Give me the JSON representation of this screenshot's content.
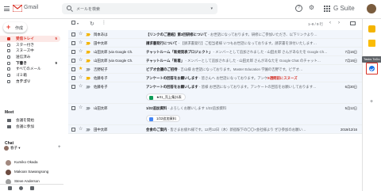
{
  "header": {
    "app_name": "Gmail",
    "search_placeholder": "メールを検索",
    "brand": "G Suite",
    "help_icon": "?",
    "settings_icon": "⚙"
  },
  "sidebar": {
    "compose_label": "作成",
    "items": [
      {
        "label": "受信トレイ",
        "count": "5",
        "active": true,
        "bold": true
      },
      {
        "label": "スター付き",
        "count": "",
        "active": false,
        "bold": false
      },
      {
        "label": "スヌーズ中",
        "count": "",
        "active": false,
        "bold": false
      },
      {
        "label": "送信済み",
        "count": "",
        "active": false,
        "bold": false
      },
      {
        "label": "下書き",
        "count": "9",
        "active": false,
        "bold": true
      },
      {
        "label": "すべてのメール",
        "count": "",
        "active": false,
        "bold": false
      },
      {
        "label": "ゴミ箱",
        "count": "",
        "active": false,
        "bold": false
      },
      {
        "label": "カテゴリ",
        "count": "",
        "active": false,
        "bold": true
      }
    ],
    "meet_heading": "Meet",
    "meet_items": [
      "会議を開始",
      "会議に参加"
    ],
    "chat_heading": "Chat",
    "me_label": "春子 ▾",
    "contacts": [
      {
        "name": "Kumiko Okada",
        "color": "#a1887f"
      },
      {
        "name": "Makoan Sawangsong",
        "color": "#6d4c41"
      },
      {
        "name": "Steve Anderson",
        "color": "#9e9e9e"
      }
    ]
  },
  "toolbar": {
    "refresh_icon": "↻",
    "more_icon": "⋮",
    "pager": "1–9 / 9 行",
    "prev_icon": "‹",
    "next_icon": "›"
  },
  "emails": [
    {
      "sender": "岡本あは",
      "subject": "【リンクのご連絡】第3回研修について",
      "snippet": " - お世話になっております。研修にご参加いただき、以下リンクより…",
      "date": "",
      "starred": false,
      "important": true,
      "badge": ""
    },
    {
      "sender": "田中太郎",
      "subject": "請求書発行について",
      "snippet": " - 【請求書発行】ご担当者様 いつもお世話になっております。請求書を添付いたします…",
      "date": "",
      "starred": false,
      "important": true,
      "badge": ""
    },
    {
      "sender": "山田太郎 (via Google Ch.",
      "subject": "チャットルーム「新規発表プロジェクト」",
      "snippet": " - メンバーとして追加されました - 山田太郎 さんがあなたを Google Ch…",
      "date": "7月16日",
      "starred": false,
      "important": true,
      "badge": ""
    },
    {
      "sender": "山田太郎 (via Google Ch.",
      "subject": "チャットルーム「新着」",
      "snippet": " - メンバーとして追加されました - 山田太郎 さんがあなたを Google Chat のチャット…",
      "date": "7月16日",
      "starred": false,
      "important": true,
      "badge": ""
    },
    {
      "sender": "吉野紀子",
      "subject": "ビデオ会議のご招待",
      "snippet": " - 吉山様 お世話になっております。Master Education 学園の吉野です。ビデオ…",
      "date": "",
      "starred": true,
      "important": false,
      "badge": ""
    },
    {
      "sender": "佐藤冬子",
      "subject": "アンケートの回答をお願いします",
      "snippet": " - 皆さんへ お世話になっております。アンケート…",
      "date": "",
      "starred": false,
      "important": true,
      "badge": "③週間前にスヌーズ"
    },
    {
      "sender": "佐藤冬子",
      "subject": "アンケートの回答をお願いします",
      "snippet": " - 皆様 お世話になっております。アンケートの回答をお願いしております…",
      "date": "6月30日",
      "starred": false,
      "important": false,
      "badge": "",
      "attachment": {
        "label": "★01_売上集計表",
        "color": "#0f9d58"
      }
    },
    {
      "sender": "山田太郎",
      "subject": "1/22追加資料",
      "snippet": " - よろしくお願いします 1/22追加資料",
      "date": "5月12日",
      "starred": false,
      "important": false,
      "badge": "",
      "attachment": {
        "label": "1/22追加資料",
        "color": "#4285f4"
      }
    },
    {
      "sender": "田中太郎",
      "subject": "会食のご案内",
      "snippet": " - 皆さまお疲れ様です。12月12日（木）新宿駅下の〇〇×会社様より ぜひ参加のお願い…",
      "date": "2019/12/16",
      "starred": false,
      "important": false,
      "badge": ""
    }
  ],
  "right_panel": {
    "tasks_tooltip": "Tasks ToDo",
    "add_icon": "+"
  }
}
